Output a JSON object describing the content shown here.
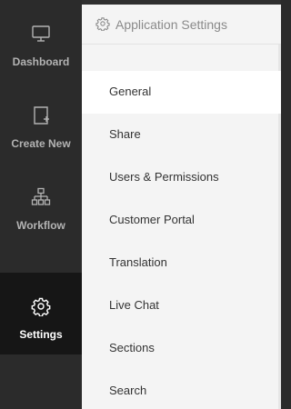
{
  "rail": {
    "items": [
      {
        "label": "Dashboard",
        "icon": "monitor-icon"
      },
      {
        "label": "Create New",
        "icon": "new-document-icon"
      },
      {
        "label": "Workflow",
        "icon": "workflow-icon"
      },
      {
        "label": "Settings",
        "icon": "gear-icon",
        "active": true
      }
    ]
  },
  "panel": {
    "title": "Application Settings",
    "menu": [
      "General",
      "Share",
      "Users & Permissions",
      "Customer Portal",
      "Translation",
      "Live Chat",
      "Sections",
      "Search"
    ],
    "selected": "General"
  },
  "colors": {
    "rail_bg": "#2b2b2b",
    "rail_active_bg": "#161616",
    "panel_bg": "#f4f4f4",
    "selected_bg": "#ffffff"
  }
}
